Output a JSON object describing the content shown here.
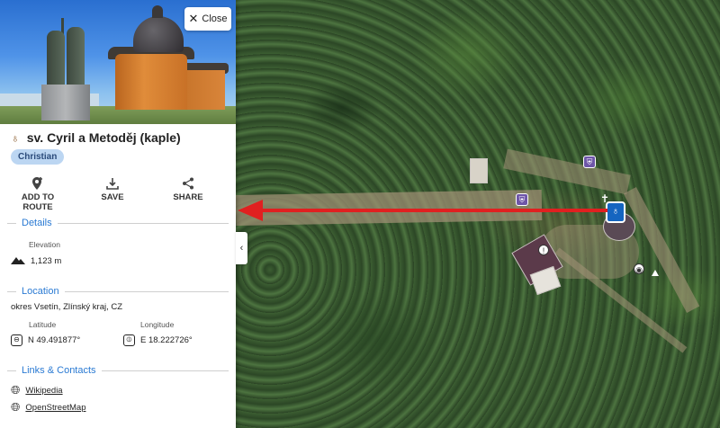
{
  "panel": {
    "close_label": "Close",
    "title": "sv. Cyril a Metoděj (kaple)",
    "category_tag": "Christian",
    "actions": [
      {
        "label": "ADD TO ROUTE",
        "icon": "add-location-icon"
      },
      {
        "label": "SAVE",
        "icon": "download-icon"
      },
      {
        "label": "SHARE",
        "icon": "share-icon"
      }
    ],
    "details": {
      "heading": "Details",
      "elevation_label": "Elevation",
      "elevation_value": "1,123 m"
    },
    "location": {
      "heading": "Location",
      "address": "okres Vsetín, Zlínský kraj, CZ",
      "latitude_label": "Latitude",
      "latitude_value": "N 49.491877°",
      "longitude_label": "Longitude",
      "longitude_value": "E 18.222726°"
    },
    "links": {
      "heading": "Links & Contacts",
      "items": [
        "Wikipedia",
        "OpenStreetMap"
      ]
    }
  },
  "colors": {
    "accent": "#2a7ad3",
    "tag_bg": "#bcd6f2",
    "arrow": "#e02020",
    "marker": "#1565c0",
    "poi": "#6e56a8"
  }
}
